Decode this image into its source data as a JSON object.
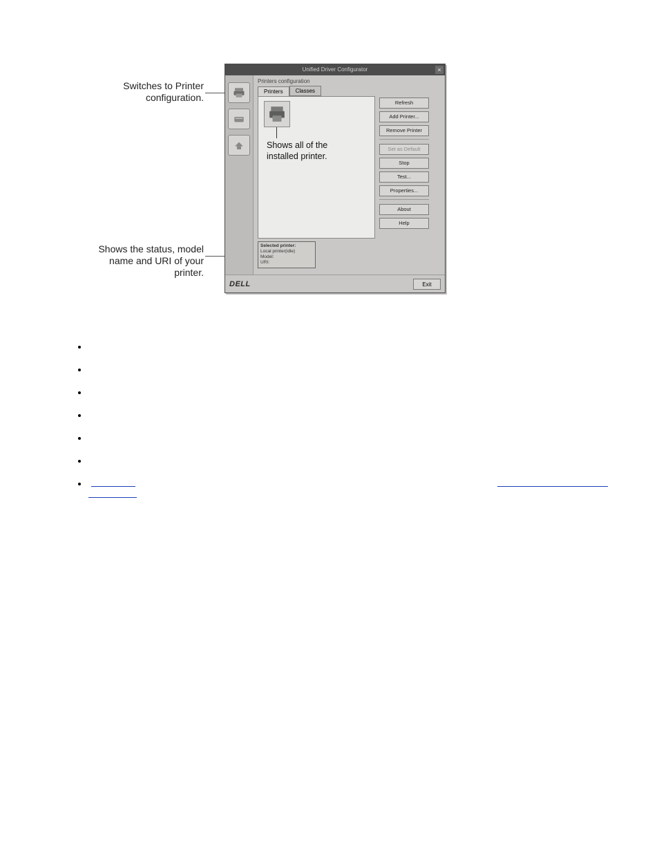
{
  "annotations": {
    "switch_label_l1": "Switches to Printer",
    "switch_label_l2": "configuration.",
    "status_label_l1": "Shows the status, model",
    "status_label_l2": "name and URI of your",
    "status_label_l3": "printer."
  },
  "window": {
    "title": "Unified Driver Configurator",
    "close_glyph": "×",
    "section_label": "Printers configuration",
    "tabs": {
      "printers": "Printers",
      "classes": "Classes"
    },
    "printer_callout_l1": "Shows all of the",
    "printer_callout_l2": "installed printer.",
    "buttons": {
      "refresh": "Refresh",
      "add": "Add Printer...",
      "remove": "Remove Printer",
      "set_default": "Set as Default",
      "stop": "Stop",
      "test": "Test...",
      "properties": "Properties...",
      "about": "About",
      "help": "Help"
    },
    "info": {
      "header": "Selected printer:",
      "line1": "Local printer(idle)",
      "line2": "Model:",
      "line3": "URI:"
    },
    "brand": "DELL",
    "exit": "Exit"
  },
  "bullets": {
    "items": [
      "",
      "",
      "",
      "",
      "",
      "",
      ""
    ]
  }
}
